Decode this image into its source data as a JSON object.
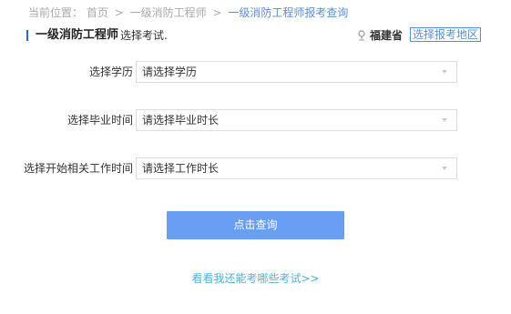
{
  "breadcrumb": {
    "prefix": "当前位置：",
    "items": [
      "首页",
      "一级消防工程师",
      "一级消防工程师报考查询"
    ],
    "separator": ">"
  },
  "header": {
    "title": "一级消防工程师",
    "subtitle": "选择考试.",
    "location_icon": "location-pin-icon",
    "location": "福建省",
    "region_button": "选择报考地区"
  },
  "form": {
    "education": {
      "label": "选择学历",
      "value": "请选择学历"
    },
    "graduation": {
      "label": "选择毕业时间",
      "value": "请选择毕业时长"
    },
    "work_start": {
      "label": "选择开始相关工作时间",
      "value": "请选择工作时长"
    }
  },
  "actions": {
    "query_button": "点击查询",
    "more_link": "看看我还能考哪些考试>>"
  },
  "colors": {
    "accent": "#5b8fd8",
    "button": "#6a9ef5",
    "link": "#4fb3d6"
  }
}
